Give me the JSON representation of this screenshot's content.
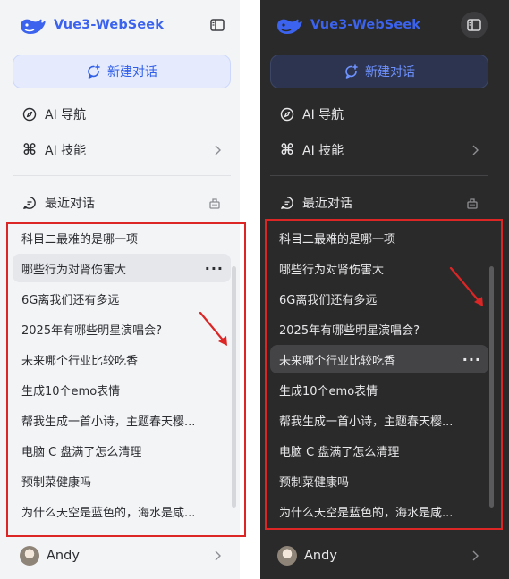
{
  "app": {
    "title": "Vue3-WebSeek",
    "brand_color": "#3b63ee"
  },
  "sidebar": {
    "new_chat_label": "新建对话",
    "nav": [
      {
        "label": "AI 导航",
        "icon": "compass-icon"
      },
      {
        "label": "AI 技能",
        "icon": "command-icon"
      }
    ],
    "recent_title": "最近对话",
    "conversations": [
      "科目二最难的是哪一项",
      "哪些行为对肾伤害大",
      "6G离我们还有多远",
      "2025年有哪些明星演唱会?",
      "未来哪个行业比较吃香",
      "生成10个emo表情",
      "帮我生成一首小诗，主题春天樱...",
      "电脑 C 盘满了怎么清理",
      "预制菜健康吗",
      "为什么天空是蓝色的，海水是咸..."
    ],
    "more_label": "···",
    "user_name": "Andy"
  },
  "themes": {
    "light": {
      "active_index": 1
    },
    "dark": {
      "active_index": 4
    }
  },
  "annotation_color": "#dc2626"
}
